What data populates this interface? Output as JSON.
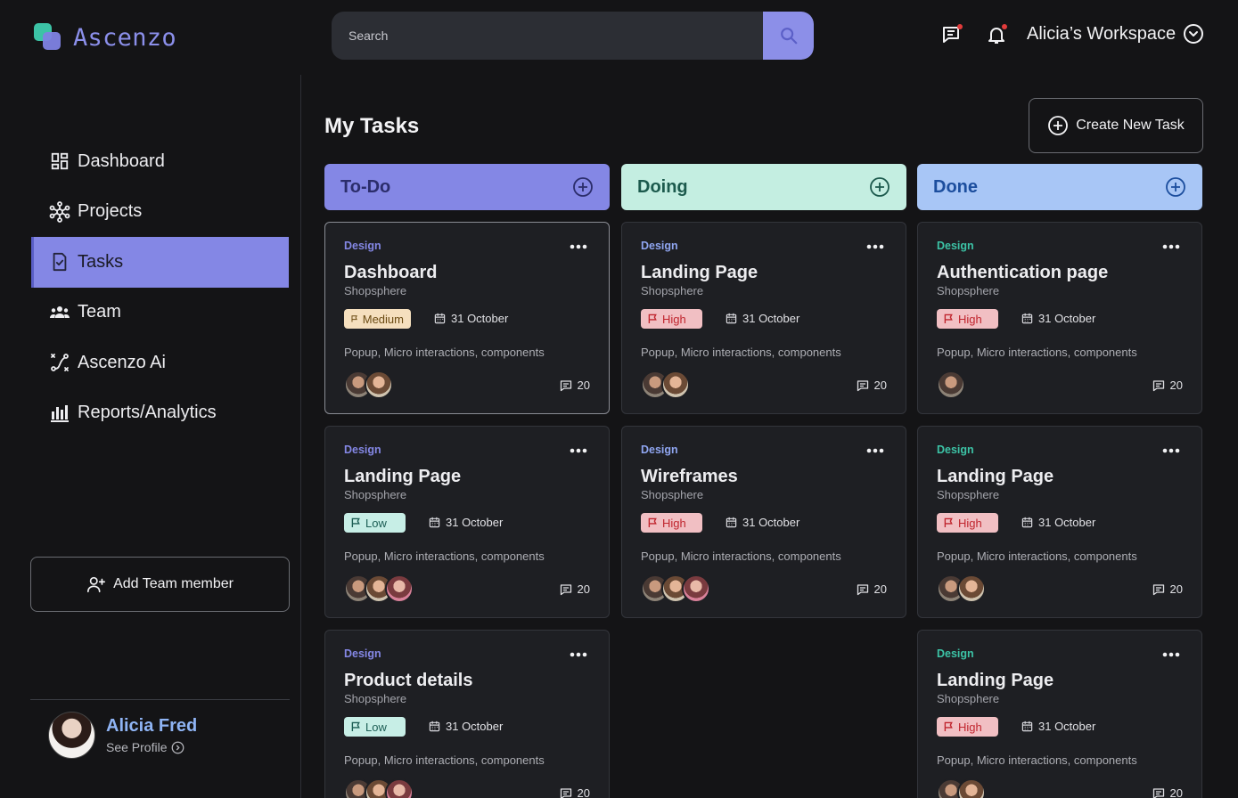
{
  "app": {
    "name": "Ascenzo"
  },
  "search": {
    "placeholder": "Search"
  },
  "header": {
    "workspace": "Alicia’s Workspace"
  },
  "sidebar": {
    "items": [
      {
        "label": "Dashboard",
        "icon": "dashboard-icon",
        "active": false
      },
      {
        "label": "Projects",
        "icon": "projects-icon",
        "active": false
      },
      {
        "label": "Tasks",
        "icon": "tasks-icon",
        "active": true
      },
      {
        "label": "Team",
        "icon": "team-icon",
        "active": false
      },
      {
        "label": "Ascenzo Ai",
        "icon": "ai-icon",
        "active": false
      },
      {
        "label": "Reports/Analytics",
        "icon": "reports-icon",
        "active": false
      }
    ],
    "add_member_label": "Add Team member"
  },
  "profile": {
    "name": "Alicia Fred",
    "link": "See Profile"
  },
  "main": {
    "title": "My Tasks",
    "create_label": "Create New Task",
    "columns": [
      {
        "label": "To-Do",
        "color": "#8487E5",
        "text_color": "#2B2D6B",
        "cards": [
          {
            "tag": "Design",
            "title": "Dashboard",
            "project": "Shopsphere",
            "priority": "Medium",
            "date": "31 October",
            "desc": "Popup, Micro interactions, components",
            "comments": "20",
            "avatars": 2
          },
          {
            "tag": "Design",
            "title": "Landing Page",
            "project": "Shopsphere",
            "priority": "Low",
            "date": "31 October",
            "desc": "Popup, Micro interactions, components",
            "comments": "20",
            "avatars": 3
          },
          {
            "tag": "Design",
            "title": "Product details",
            "project": "Shopsphere",
            "priority": "Low",
            "date": "31 October",
            "desc": "Popup, Micro interactions, components",
            "comments": "20",
            "avatars": 3
          }
        ]
      },
      {
        "label": "Doing",
        "color": "#C4EEE1",
        "text_color": "#1C5A4D",
        "cards": [
          {
            "tag": "Design",
            "title": "Landing Page",
            "project": "Shopsphere",
            "priority": "High",
            "date": "31 October",
            "desc": "Popup, Micro interactions, components",
            "comments": "20",
            "avatars": 2
          },
          {
            "tag": "Design",
            "title": "Wireframes",
            "project": "Shopsphere",
            "priority": "High",
            "date": "31 October",
            "desc": "Popup, Micro interactions, components",
            "comments": "20",
            "avatars": 3
          }
        ]
      },
      {
        "label": "Done",
        "color": "#A8C6F6",
        "text_color": "#1C4E9E",
        "cards": [
          {
            "tag": "Design",
            "title": "Authentication page",
            "project": "Shopsphere",
            "priority": "High",
            "date": "31 October",
            "desc": "Popup, Micro interactions, components",
            "comments": "20",
            "avatars": 1
          },
          {
            "tag": "Design",
            "title": "Landing Page",
            "project": "Shopsphere",
            "priority": "High",
            "date": "31 October",
            "desc": "Popup, Micro interactions, components",
            "comments": "20",
            "avatars": 2
          },
          {
            "tag": "Design",
            "title": "Landing Page",
            "project": "Shopsphere",
            "priority": "High",
            "date": "31 October",
            "desc": "Popup, Micro interactions, components",
            "comments": "20",
            "avatars": 2
          }
        ]
      }
    ]
  },
  "colors": {
    "accent": "#8487E5",
    "tag_todo": "#8487E5",
    "tag_doing": "#8FA5F0",
    "tag_done": "#3CC3A6"
  }
}
